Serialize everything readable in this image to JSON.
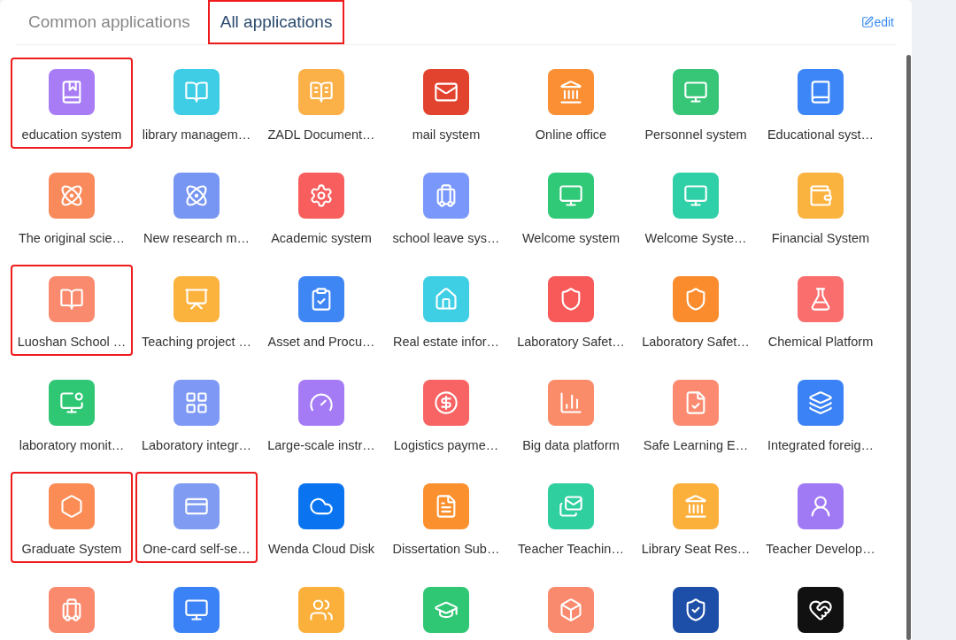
{
  "tabs": [
    {
      "label": "Common applications",
      "selected": false,
      "highlighted": false
    },
    {
      "label": "All applications",
      "selected": true,
      "highlighted": true
    }
  ],
  "edit_link": "edit",
  "apps": [
    {
      "label": "education system",
      "color": "#a77cf5",
      "highlighted": true
    },
    {
      "label": "library managem…",
      "color": "#3fcde6",
      "highlighted": false
    },
    {
      "label": "ZADL Document…",
      "color": "#fbb048",
      "highlighted": false
    },
    {
      "label": "mail system",
      "color": "#e2432e",
      "highlighted": false
    },
    {
      "label": "Online office",
      "color": "#fb8f33",
      "highlighted": false
    },
    {
      "label": "Personnel system",
      "color": "#37c577",
      "highlighted": false
    },
    {
      "label": "Educational syst…",
      "color": "#3d86f7",
      "highlighted": false
    },
    {
      "label": "The original scie…",
      "color": "#f98a5c",
      "highlighted": false
    },
    {
      "label": "New research m…",
      "color": "#7795f2",
      "highlighted": false
    },
    {
      "label": "Academic system",
      "color": "#f85e5e",
      "highlighted": false
    },
    {
      "label": "school leave sys…",
      "color": "#7a98fb",
      "highlighted": false
    },
    {
      "label": "Welcome system",
      "color": "#2fc978",
      "highlighted": false
    },
    {
      "label": "Welcome Syste…",
      "color": "#2fd0a7",
      "highlighted": false
    },
    {
      "label": "Financial System",
      "color": "#fbb340",
      "highlighted": false
    },
    {
      "label": "Luoshan School …",
      "color": "#fa8a6d",
      "highlighted": true
    },
    {
      "label": "Teaching project …",
      "color": "#fbb33e",
      "highlighted": false
    },
    {
      "label": "Asset and Procu…",
      "color": "#3f86f5",
      "highlighted": false
    },
    {
      "label": "Real estate infor…",
      "color": "#3fcfe4",
      "highlighted": false
    },
    {
      "label": "Laboratory Safet…",
      "color": "#f85a5a",
      "highlighted": false
    },
    {
      "label": "Laboratory Safet…",
      "color": "#fb8c2e",
      "highlighted": false
    },
    {
      "label": "Chemical Platform",
      "color": "#fa6e6e",
      "highlighted": false
    },
    {
      "label": "laboratory monit…",
      "color": "#2fc674",
      "highlighted": false
    },
    {
      "label": "Laboratory integr…",
      "color": "#7d98f5",
      "highlighted": false
    },
    {
      "label": "Large-scale instr…",
      "color": "#a57af5",
      "highlighted": false
    },
    {
      "label": "Logistics payme…",
      "color": "#f86363",
      "highlighted": false
    },
    {
      "label": "Big data platform",
      "color": "#fb8c6a",
      "highlighted": false
    },
    {
      "label": "Safe Learning E…",
      "color": "#fb8a70",
      "highlighted": false
    },
    {
      "label": "Integrated foreig…",
      "color": "#3b82f6",
      "highlighted": false
    },
    {
      "label": "Graduate System",
      "color": "#fb8c55",
      "highlighted": true
    },
    {
      "label": "One-card self-se…",
      "color": "#7f9cf2",
      "highlighted": true
    },
    {
      "label": "Wenda Cloud Disk",
      "color": "#0a74f0",
      "highlighted": false
    },
    {
      "label": "Dissertation Sub…",
      "color": "#fb902e",
      "highlighted": false
    },
    {
      "label": "Teacher Teachin…",
      "color": "#2fcfa0",
      "highlighted": false
    },
    {
      "label": "Library Seat Res…",
      "color": "#fbb03c",
      "highlighted": false
    },
    {
      "label": "Teacher Develop…",
      "color": "#a07af5",
      "highlighted": false
    },
    {
      "color": "#fa8a6d",
      "highlighted": false
    },
    {
      "color": "#3b82f6",
      "highlighted": false
    },
    {
      "color": "#fbb03c",
      "highlighted": false
    },
    {
      "color": "#2fc674",
      "highlighted": false
    },
    {
      "color": "#fa8a6d",
      "highlighted": false
    },
    {
      "color": "#1e4fa8",
      "highlighted": false
    },
    {
      "color": "#111111",
      "highlighted": false
    }
  ]
}
